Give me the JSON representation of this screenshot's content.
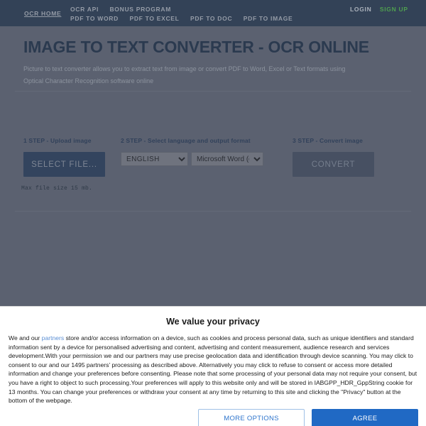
{
  "nav": {
    "home": "OCR HOME",
    "row1": [
      "OCR API",
      "BONUS PROGRAM"
    ],
    "row2": [
      "PDF TO WORD",
      "PDF TO EXCEL",
      "PDF TO DOC",
      "PDF TO IMAGE"
    ],
    "login": "LOGIN",
    "signup": "SIGN UP",
    "colors": {
      "bar_bg": "#334257",
      "link": "#949ba6",
      "signup": "#4f9f4f"
    }
  },
  "hero": {
    "title": "IMAGE TO TEXT CONVERTER - OCR ONLINE",
    "subtitle": "Picture to text converter allows you to extract text from image or convert PDF to Word, Excel or Text formats using Optical Character Recognition software online"
  },
  "steps": {
    "step1": {
      "label": "1 STEP - Upload image",
      "button": "SELECT FILE...",
      "note": "Max file size 15 mb."
    },
    "step2": {
      "label": "2 STEP - Select language and output format",
      "language_value": "ENGLISH",
      "language_options": [
        "ENGLISH"
      ],
      "format_value": "Microsoft Word (doc)",
      "format_options": [
        "Microsoft Word (doc)"
      ]
    },
    "step3": {
      "label": "3 STEP - Convert image",
      "button": "CONVERT"
    }
  },
  "consent": {
    "title": "We value your privacy",
    "body_part1": "We and our ",
    "partners_link": "partners",
    "body_part2": " store and/or access information on a device, such as cookies and process personal data, such as unique identifiers and standard information sent by a device for personalised advertising and content, advertising and content measurement, audience research and services development.With your permission we and our partners may use precise geolocation data and identification through device scanning. You may click to consent to our and our 1495 partners’ processing as described above. Alternatively you may click to refuse to consent or access more detailed information and change your preferences before consenting. Please note that some processing of your personal data may not require your consent, but you have a right to object to such processing.Your preferences will apply to this website only and will be stored in IABGPP_HDR_GppString cookie for 13 months. You can change your preferences or withdraw your consent at any time by returning to this site and clicking the \"Privacy\" button at the bottom of the webpage.",
    "more_options": "MORE OPTIONS",
    "agree": "AGREE",
    "colors": {
      "accent": "#2069c4",
      "link": "#5b8fd4"
    }
  }
}
